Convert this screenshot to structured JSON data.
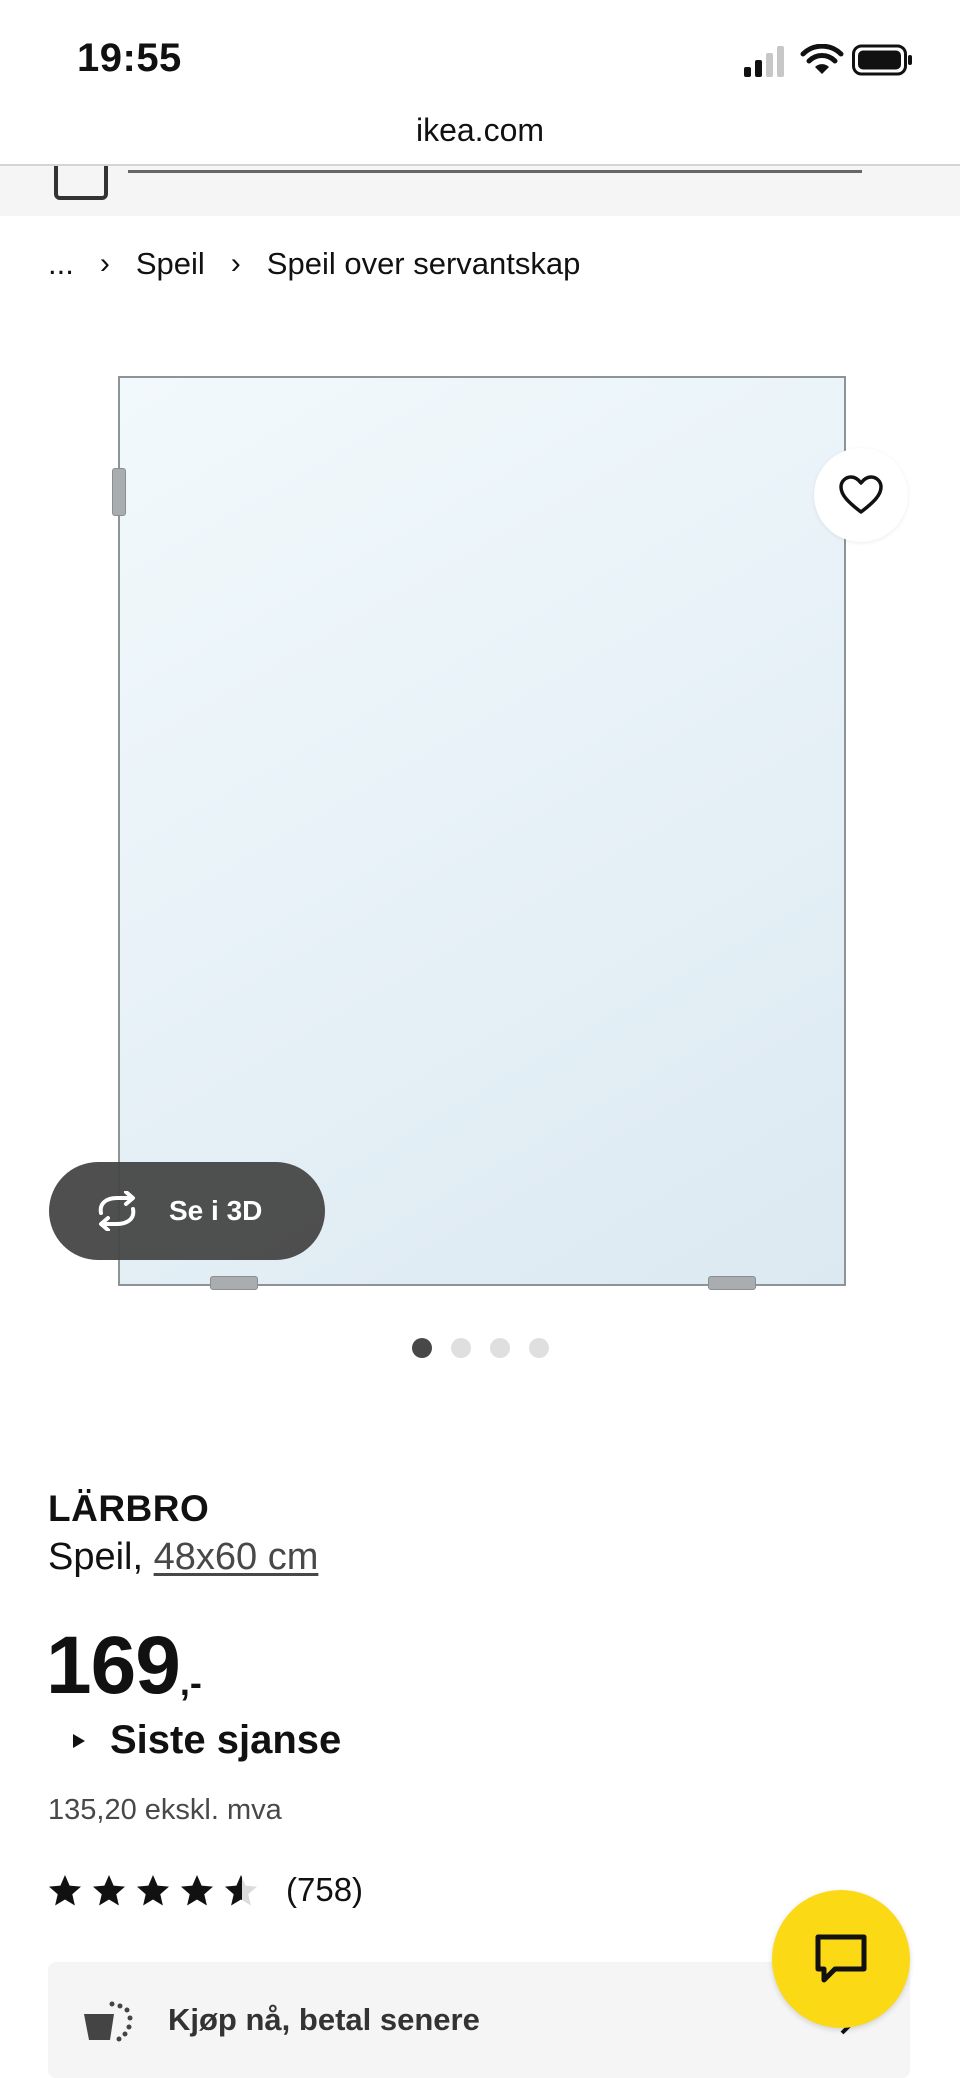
{
  "status_bar": {
    "time": "19:55"
  },
  "browser": {
    "url": "ikea.com"
  },
  "breadcrumb": {
    "items": [
      "...",
      "Speil",
      "Speil over servantskap"
    ]
  },
  "gallery": {
    "view_3d_label": "Se i 3D",
    "image_count": 4,
    "active_index": 0
  },
  "product": {
    "name": "LÄRBRO",
    "type": "Speil,",
    "size": "48x60 cm",
    "price": "169",
    "price_suffix": ",-",
    "price_tag": "Siste sjanse",
    "price_excl_vat": "135,20 ekskl. mva",
    "rating": 4.5,
    "review_count": "(758)"
  },
  "installment": {
    "label": "Kjøp nå, betal senere"
  },
  "colors": {
    "chat_button": "#fbd914",
    "accent_dark": "#111111"
  }
}
